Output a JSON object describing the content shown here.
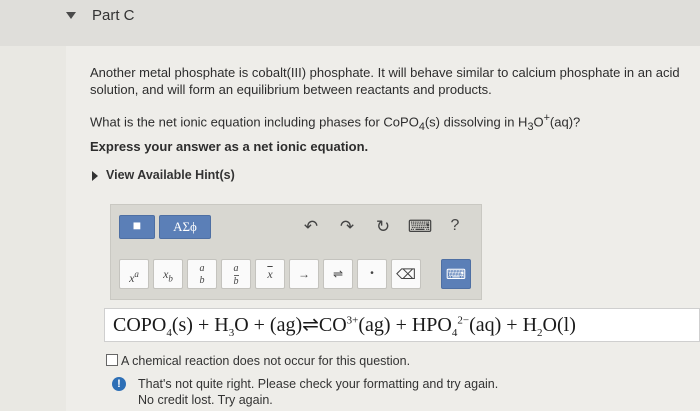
{
  "part": {
    "title": "Part C"
  },
  "question": {
    "intro": "Another metal phosphate is cobalt(III) phosphate. It will behave similar to calcium phosphate in an acid solution, and will form an equilibrium between reactants and products.",
    "prompt_a": "What is the net ionic equation including phases for CoPO",
    "prompt_sub1": "4",
    "prompt_b": "(s) dissolving in H",
    "prompt_sub2": "3",
    "prompt_c": "O",
    "prompt_sup": "+",
    "prompt_d": "(aq)?",
    "instruction": "Express your answer as a net ionic equation.",
    "hint_label": "View Available Hint(s)"
  },
  "toolbar": {
    "row1": {
      "templates_label": "■",
      "symbols_label": "ΑΣϕ",
      "undo": "↶",
      "redo": "↷",
      "reset": "↻",
      "keyboard": "⌨",
      "help": "?"
    },
    "row2": {
      "superscript": "x",
      "superscript_sup": "a",
      "subscript": "x",
      "subscript_sub": "b",
      "fraction_a": "a",
      "fraction_b": "b",
      "fraction2_a": "a",
      "fraction2_b": "b",
      "overline": "x",
      "arrow": "→",
      "equilibrium": "⇌",
      "dot": "•",
      "delete": "⌫",
      "keyboard2": "⌨"
    }
  },
  "answer": {
    "t1": "COPO",
    "s1": "4",
    "t2": "(s) + H",
    "s2": "3",
    "t3": "O + (ag)",
    "eq": "⇌",
    "t4": "CO",
    "sup1": "3+",
    "t5": "(ag) + HPO",
    "s3": "4",
    "sup2": "2−",
    "t6": "(aq) + H",
    "s4": "2",
    "t7": "O(l)"
  },
  "no_reaction_label": "A chemical reaction does not occur for this question.",
  "feedback": {
    "line1": "That's not quite right. Please check your formatting and try again.",
    "line2": "No credit lost. Try again."
  }
}
